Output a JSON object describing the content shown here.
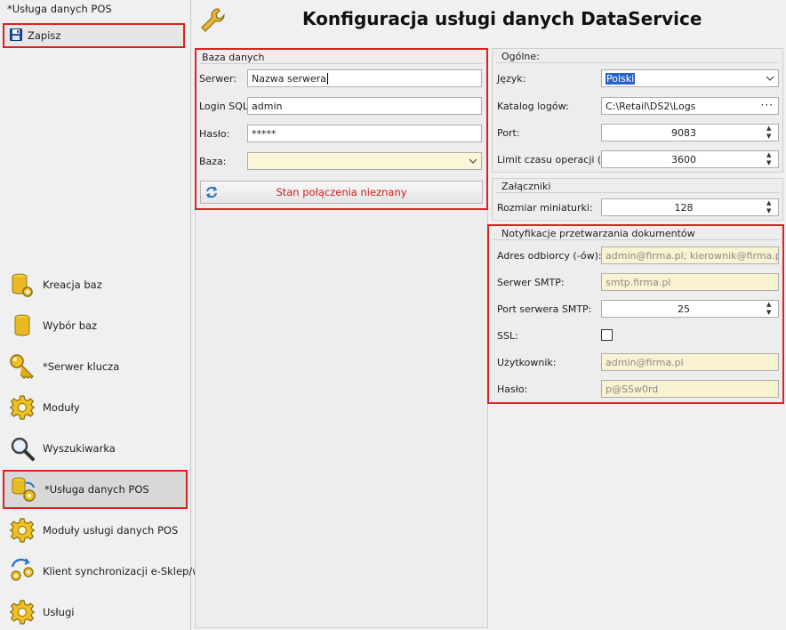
{
  "sidebar": {
    "title": "*Usługa danych POS",
    "save_label": "Zapisz",
    "items": [
      {
        "label": "Kreacja baz",
        "icon": "database-gear-icon"
      },
      {
        "label": "Wybór baz",
        "icon": "database-icon"
      },
      {
        "label": "*Serwer klucza",
        "icon": "key-icon"
      },
      {
        "label": "Moduły",
        "icon": "gear-icon"
      },
      {
        "label": "Wyszukiwarka",
        "icon": "magnifier-icon"
      },
      {
        "label": "*Usługa danych POS",
        "icon": "database-sync-icon"
      },
      {
        "label": "Moduły usługi danych POS",
        "icon": "gear-icon"
      },
      {
        "label": "Klient synchronizacji e-Sklep/wszy",
        "icon": "sync-gear-icon"
      },
      {
        "label": "Usługi",
        "icon": "gear-icon"
      }
    ]
  },
  "header": {
    "title": "Konfiguracja usługi danych DataService"
  },
  "database": {
    "group_title": "Baza danych",
    "server_label": "Serwer:",
    "server_value": "Nazwa serwera",
    "login_label": "Login SQL:",
    "login_value": "admin",
    "password_label": "Hasło:",
    "password_value": "*****",
    "db_label": "Baza:",
    "db_value": "",
    "status_label": "Stan połączenia nieznany"
  },
  "general": {
    "group_title": "Ogólne:",
    "language_label": "Język:",
    "language_value": "Polski",
    "logs_label": "Katalog logów:",
    "logs_value": "C:\\Retail\\DS2\\Logs",
    "logs_browse": "···",
    "port_label": "Port:",
    "port_value": "9083",
    "timeout_label": "Limit czasu operacji (s):",
    "timeout_value": "3600"
  },
  "attachments": {
    "group_title": "Załączniki",
    "thumb_label": "Rozmiar miniaturki:",
    "thumb_value": "128"
  },
  "notifications": {
    "group_title": "Notyfikacje przetwarzania dokumentów",
    "recipients_label": "Adres odbiorcy (-ów):",
    "recipients_value": "admin@firma.pl; kierownik@firma.pl",
    "smtp_label": "Serwer SMTP:",
    "smtp_value": "smtp.firma.pl",
    "smtp_port_label": "Port serwera SMTP:",
    "smtp_port_value": "25",
    "ssl_label": "SSL:",
    "user_label": "Użytkownik:",
    "user_value": "admin@firma.pl",
    "pass_label": "Hasło:",
    "pass_value": "p@SSw0rd"
  },
  "colors": {
    "highlight": "#e02020",
    "status_text": "#d41a1a",
    "readonly_bg": "#faf3d1",
    "selection": "#2a62c9"
  }
}
